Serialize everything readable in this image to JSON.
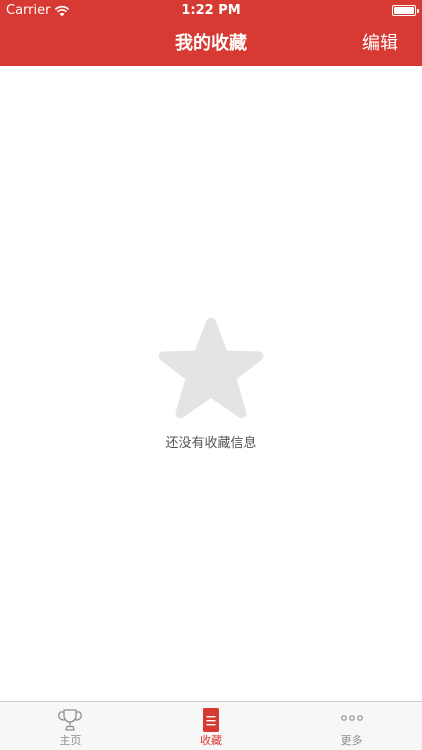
{
  "status_bar": {
    "carrier": "Carrier",
    "time": "1:22 PM",
    "icons": [
      "wifi-icon",
      "battery-icon"
    ]
  },
  "nav": {
    "title": "我的收藏",
    "edit_label": "编辑"
  },
  "empty_state": {
    "icon": "star-icon",
    "message": "还没有收藏信息"
  },
  "tabs": [
    {
      "label": "主页",
      "icon": "trophy-icon",
      "active": false
    },
    {
      "label": "收藏",
      "icon": "list-document-icon",
      "active": true
    },
    {
      "label": "更多",
      "icon": "more-dots-icon",
      "active": false
    }
  ],
  "colors": {
    "primary": "#d63a32",
    "tab_inactive": "#8e8e8e",
    "star_placeholder": "#e4e4e4",
    "tab_bar_bg": "#f7f7f7"
  }
}
